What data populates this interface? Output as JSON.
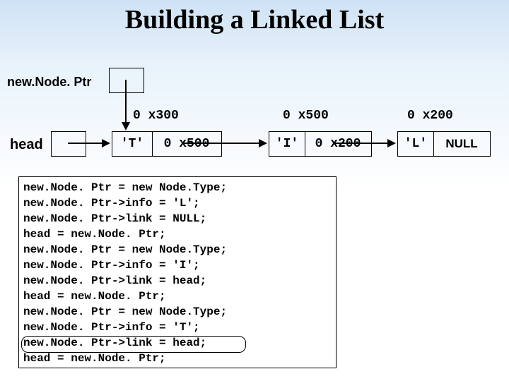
{
  "title": "Building a Linked List",
  "labels": {
    "newNodePtr": "new.Node. Ptr",
    "head": "head"
  },
  "addresses": {
    "n1": "0 x300",
    "n2": "0 x500",
    "n3": "0 x200"
  },
  "nodes": {
    "n1": {
      "info": "'T'",
      "link": "0 x500"
    },
    "n2": {
      "info": "'I'",
      "link": "0 x200"
    },
    "n3": {
      "info": "'L'",
      "link": "NULL"
    }
  },
  "code": {
    "l1": "new.Node. Ptr = new Node.Type;",
    "l2": "new.Node. Ptr->info = 'L';",
    "l3": "new.Node. Ptr->link = NULL;",
    "l4": "head = new.Node. Ptr;",
    "l5": "new.Node. Ptr = new Node.Type;",
    "l6": "new.Node. Ptr->info = 'I';",
    "l7": "new.Node. Ptr->link = head;",
    "l8": "head = new.Node. Ptr;",
    "l9": "new.Node. Ptr = new Node.Type;",
    "l10": "new.Node. Ptr->info = 'T';",
    "l11": "new.Node. Ptr->link = head;",
    "l12": "head = new.Node. Ptr;"
  }
}
